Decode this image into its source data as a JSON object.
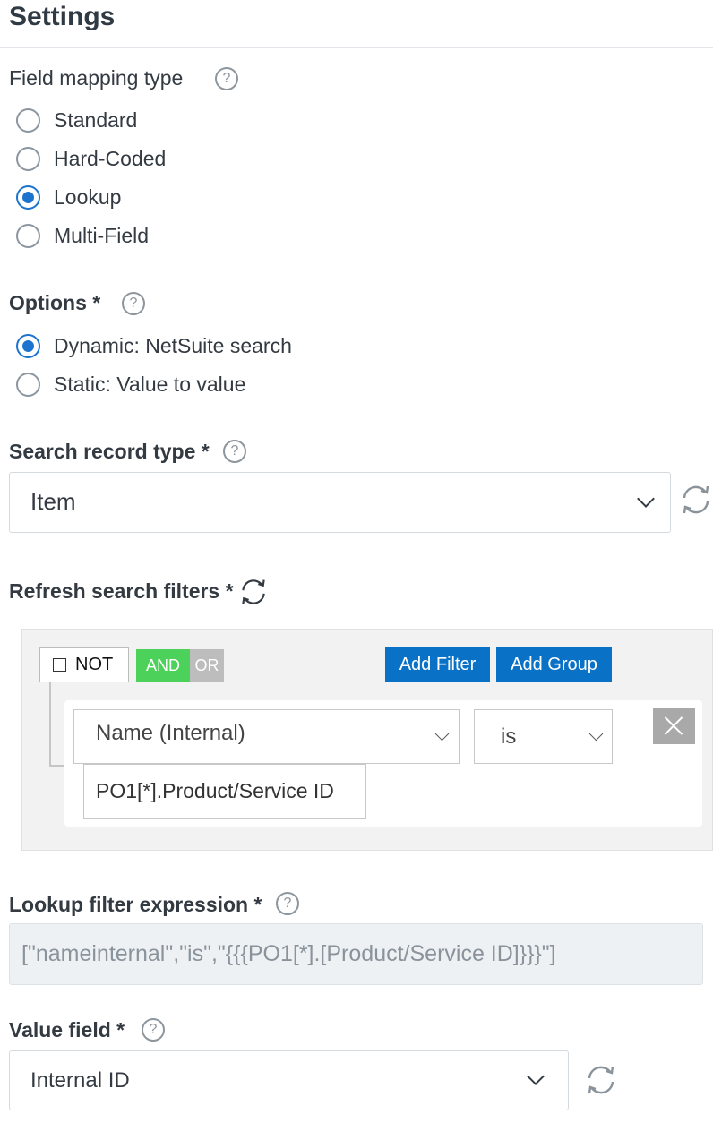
{
  "title": "Settings",
  "mapping": {
    "label": "Field mapping type",
    "help": "?",
    "options": [
      {
        "label": "Standard",
        "checked": false
      },
      {
        "label": "Hard-Coded",
        "checked": false
      },
      {
        "label": "Lookup",
        "checked": true
      },
      {
        "label": "Multi-Field",
        "checked": false
      }
    ]
  },
  "options_group": {
    "label": "Options *",
    "help": "?",
    "options": [
      {
        "label": "Dynamic: NetSuite search",
        "checked": true
      },
      {
        "label": "Static: Value to value",
        "checked": false
      }
    ]
  },
  "search_record": {
    "label": "Search record type *",
    "help": "?",
    "value": "Item"
  },
  "refresh_filters": {
    "label": "Refresh search filters *"
  },
  "filter_builder": {
    "not_label": "NOT",
    "and_label": "AND",
    "or_label": "OR",
    "add_filter_label": "Add Filter",
    "add_group_label": "Add Group",
    "rule": {
      "field": "Name (Internal)",
      "operator": "is",
      "value": "PO1[*].Product/Service ID"
    }
  },
  "lookup_expr": {
    "label": "Lookup filter expression *",
    "help": "?",
    "value": "[\"nameinternal\",\"is\",\"{{{PO1[*].[Product/Service ID]}}}\"]"
  },
  "value_field": {
    "label": "Value field *",
    "help": "?",
    "value": "Internal ID"
  },
  "colors": {
    "accent": "#1d74cf",
    "button_blue": "#0a72c6",
    "and_green": "#4cd25a"
  }
}
